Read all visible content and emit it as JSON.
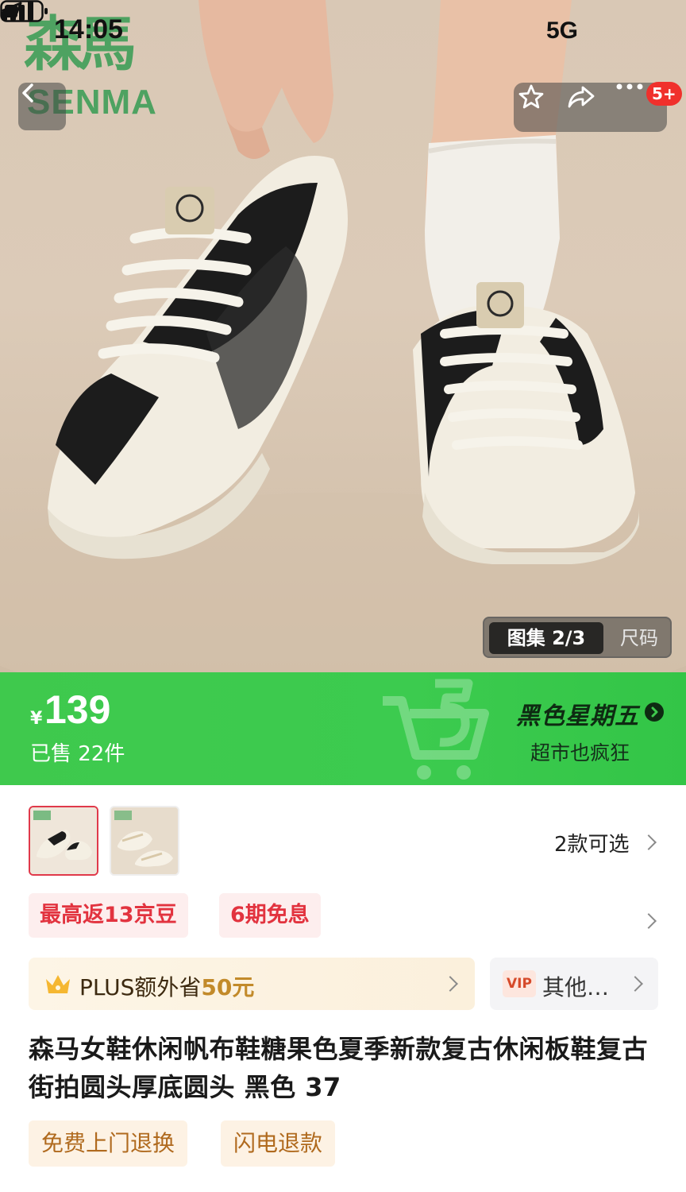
{
  "status_bar": {
    "time": "14:05",
    "network": "5G"
  },
  "brand": {
    "logo_cn": "森馬",
    "logo_en": "SENMA"
  },
  "header": {
    "back_icon": "chevron-left-icon",
    "actions": [
      "star-icon",
      "share-icon",
      "more-icon"
    ],
    "badge": "5+"
  },
  "gallery": {
    "active_label": "图集 2/3",
    "other_label": "尺码"
  },
  "price_banner": {
    "currency": "¥",
    "price": "139",
    "sold": "已售 22件",
    "promo_title": "黑色星期五",
    "promo_sub": "超市也疯狂",
    "colors": {
      "bg": "#3fc94d",
      "promo_text": "#0e2b12"
    }
  },
  "variants": {
    "count_label": "2款可选",
    "thumbnails": [
      "black-shoe-variant",
      "beige-shoe-variant"
    ]
  },
  "tags": {
    "jd_bean": "最高返13京豆",
    "interest_free": "6期免息"
  },
  "plus": {
    "prefix": "PLUS额外省",
    "amount": "50元"
  },
  "vip": {
    "badge": "VIP",
    "text": "其他…"
  },
  "product": {
    "title": "森马女鞋休闲帆布鞋糖果色夏季新款复古休闲板鞋复古街拍圆头厚底圆头 黑色 37"
  },
  "services": [
    "免费上门退换",
    "闪电退款"
  ],
  "accent_colors": {
    "red": "#e2333f",
    "gold": "#c28a2a",
    "green": "#3fc94d"
  }
}
